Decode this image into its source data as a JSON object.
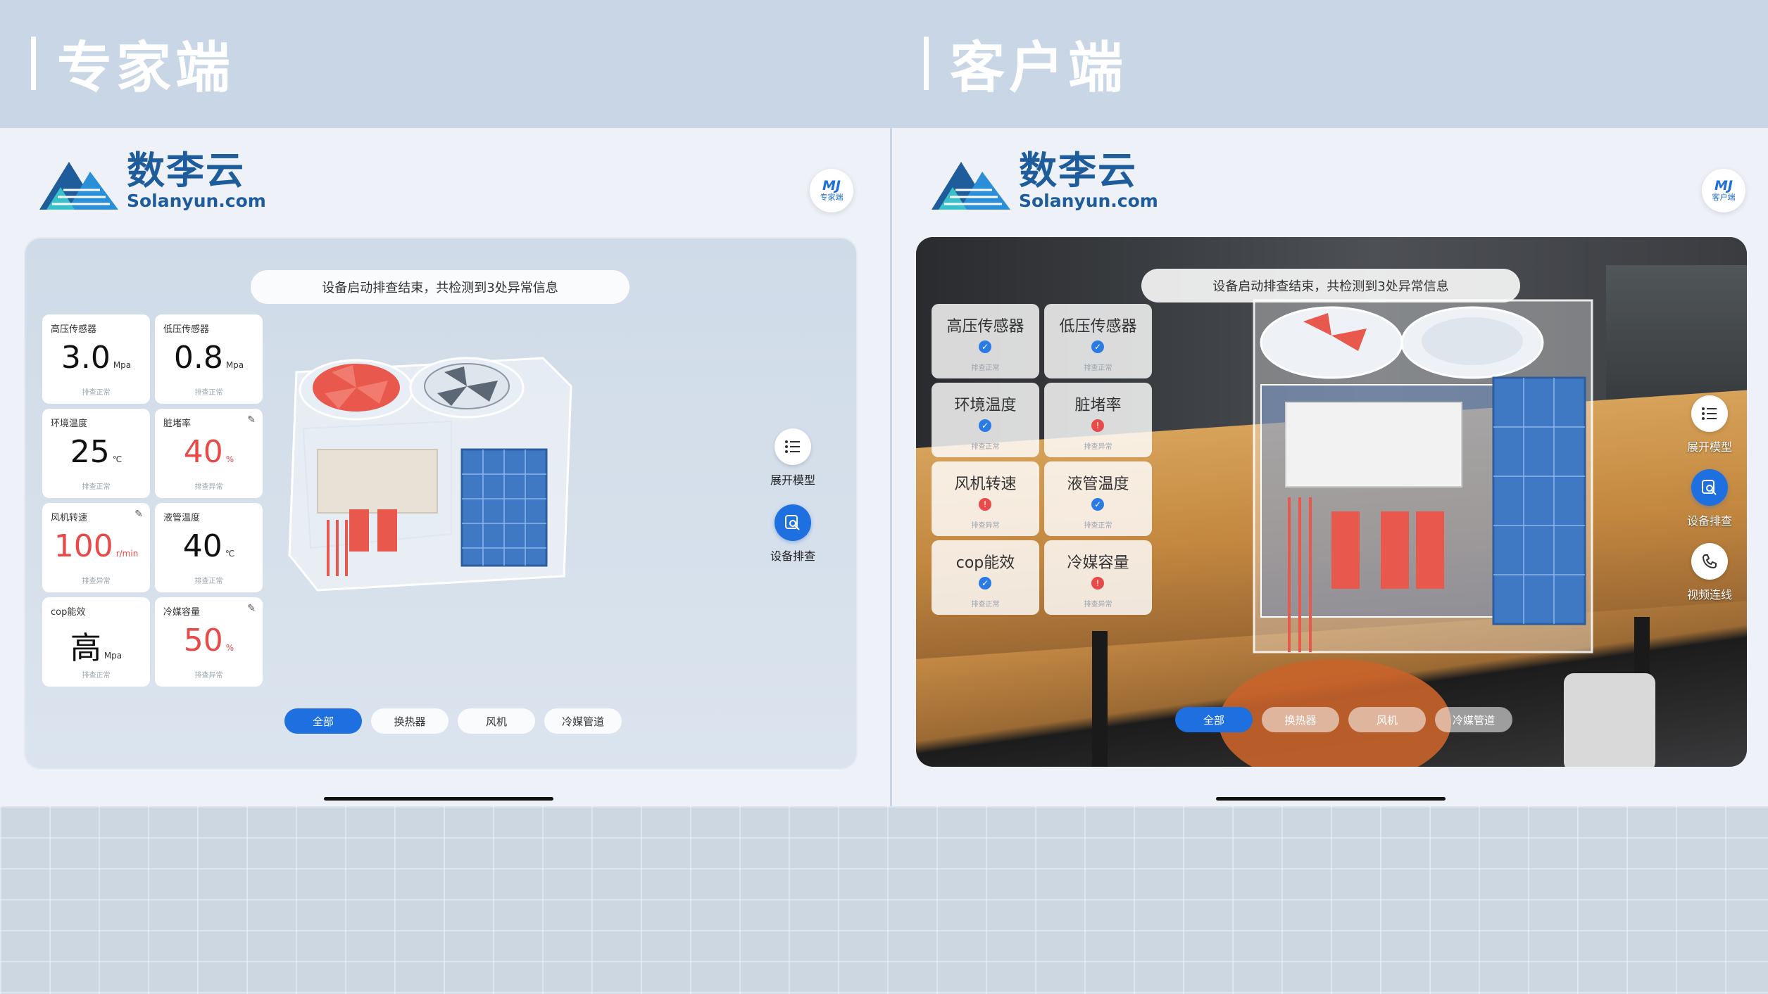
{
  "headings": {
    "expert": "专家端",
    "customer": "客户端"
  },
  "brand": {
    "name_cn": "数李云",
    "domain": "Solanyun.com"
  },
  "expert": {
    "avatar_mark": "MJ",
    "avatar_label": "专家端",
    "notice": "设备启动排查结束，共检测到3处异常信息",
    "cards": [
      {
        "name": "高压传感器",
        "value": "3.0",
        "unit": "Mpa",
        "status": "排查正常",
        "edit": false
      },
      {
        "name": "低压传感器",
        "value": "0.8",
        "unit": "Mpa",
        "status": "排查正常",
        "edit": false
      },
      {
        "name": "环境温度",
        "value": "25",
        "unit": "℃",
        "status": "排查正常",
        "edit": false
      },
      {
        "name": "脏堵率",
        "value": "40",
        "unit": "%",
        "status": "排查异常",
        "edit": true
      },
      {
        "name": "风机转速",
        "value": "100",
        "unit": "r/min",
        "status": "排查异常",
        "edit": true
      },
      {
        "name": "液管温度",
        "value": "40",
        "unit": "℃",
        "status": "排查正常",
        "edit": false
      },
      {
        "name": "cop能效",
        "value": "高",
        "unit": "Mpa",
        "status": "排查正常",
        "edit": false
      },
      {
        "name": "冷媒容量",
        "value": "50",
        "unit": "%",
        "status": "排查异常",
        "edit": true
      }
    ],
    "tools": {
      "expand": "展开模型",
      "inspect": "设备排查"
    },
    "filters": [
      "全部",
      "换热器",
      "风机",
      "冷媒管道"
    ]
  },
  "customer": {
    "avatar_mark": "MJ",
    "avatar_label": "客户端",
    "notice": "设备启动排查结束，共检测到3处异常信息",
    "cards": [
      {
        "name": "高压传感器",
        "status": "排查正常",
        "state": "ok"
      },
      {
        "name": "低压传感器",
        "status": "排查正常",
        "state": "ok"
      },
      {
        "name": "环境温度",
        "status": "排查正常",
        "state": "ok"
      },
      {
        "name": "脏堵率",
        "status": "排查异常",
        "state": "err"
      },
      {
        "name": "风机转速",
        "status": "排查异常",
        "state": "err"
      },
      {
        "name": "液管温度",
        "status": "排查正常",
        "state": "ok"
      },
      {
        "name": "cop能效",
        "status": "排查正常",
        "state": "ok"
      },
      {
        "name": "冷媒容量",
        "status": "排查异常",
        "state": "err"
      }
    ],
    "tools": {
      "expand": "展开模型",
      "inspect": "设备排查",
      "video": "视频连线"
    },
    "filters": [
      "全部",
      "换热器",
      "风机",
      "冷媒管道"
    ]
  },
  "colors": {
    "accent": "#1e6fe0",
    "error": "#e84a4a",
    "brand": "#1f5c9c"
  }
}
